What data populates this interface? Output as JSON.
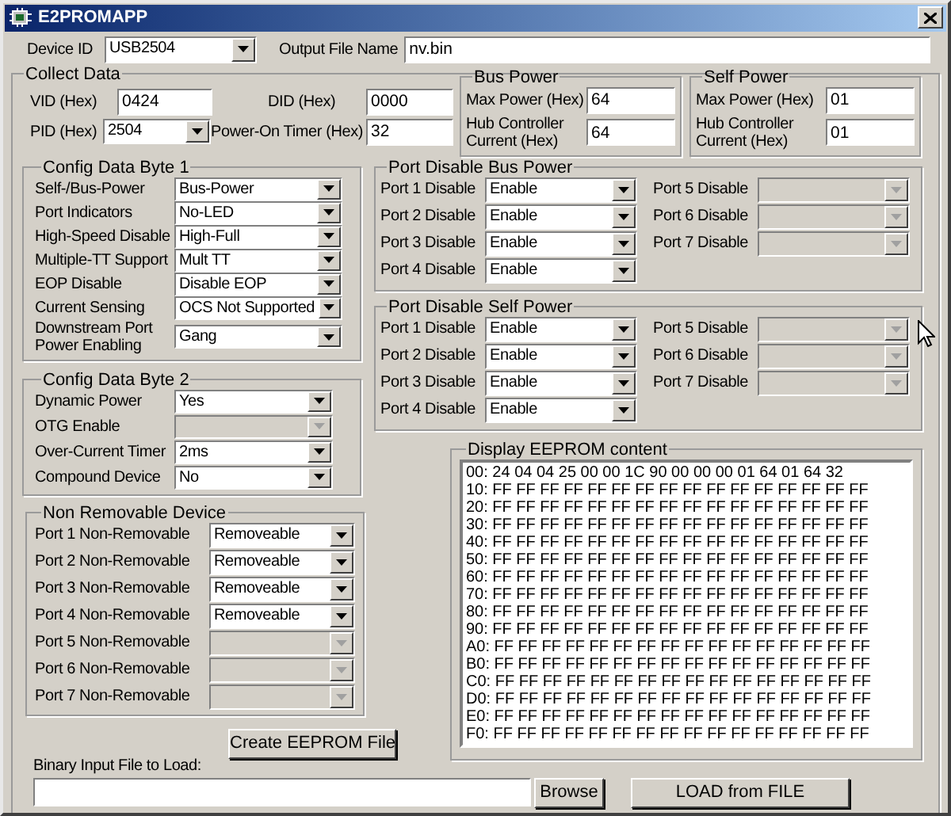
{
  "window": {
    "title": "E2PROMAPP"
  },
  "device_id": {
    "label": "Device ID",
    "value": "USB2504"
  },
  "output_file": {
    "label": "Output File Name",
    "value": "nv.bin"
  },
  "collect_data": {
    "title": "Collect Data",
    "ids": [
      {
        "label": "VID (Hex)",
        "value": "0424",
        "kind": "text"
      },
      {
        "label": "DID (Hex)",
        "value": "0000",
        "kind": "text"
      },
      {
        "label": "PID (Hex)",
        "value": "2504",
        "kind": "combo"
      },
      {
        "label": "Power-On Timer (Hex)",
        "value": "32",
        "kind": "text"
      }
    ],
    "bus_power": {
      "title": "Bus Power",
      "fields": [
        {
          "label": "Max Power (Hex)",
          "value": "64"
        },
        {
          "label": "Hub Controller Current (Hex)",
          "value": "64"
        }
      ]
    },
    "self_power": {
      "title": "Self Power",
      "fields": [
        {
          "label": "Max Power (Hex)",
          "value": "01"
        },
        {
          "label": "Hub Controller Current (Hex)",
          "value": "01"
        }
      ]
    },
    "config_byte_1": {
      "title": "Config Data Byte 1",
      "rows": [
        {
          "label": "Self-/Bus-Power",
          "value": "Bus-Power",
          "disabled": false
        },
        {
          "label": "Port Indicators",
          "value": "No-LED",
          "disabled": false
        },
        {
          "label": "High-Speed Disable",
          "value": "High-Full",
          "disabled": false
        },
        {
          "label": "Multiple-TT Support",
          "value": "Mult TT",
          "disabled": false
        },
        {
          "label": "EOP Disable",
          "value": "Disable EOP",
          "disabled": false
        },
        {
          "label": "Current Sensing",
          "value": "OCS Not Supported",
          "disabled": false
        },
        {
          "label": "Downstream Port Power Enabling",
          "value": "Gang",
          "disabled": false
        }
      ]
    },
    "config_byte_2": {
      "title": "Config Data Byte 2",
      "rows": [
        {
          "label": "Dynamic Power",
          "value": "Yes",
          "disabled": false
        },
        {
          "label": "OTG Enable",
          "disabled": true
        },
        {
          "label": "Over-Current Timer",
          "value": "2ms",
          "disabled": false
        },
        {
          "label": "Compound Device",
          "value": "No",
          "disabled": false
        }
      ]
    },
    "non_removable": {
      "title": "Non Removable Device",
      "rows": [
        {
          "label": "Port 1 Non-Removable",
          "value": "Removeable",
          "disabled": false
        },
        {
          "label": "Port 2 Non-Removable",
          "value": "Removeable",
          "disabled": false
        },
        {
          "label": "Port 3 Non-Removable",
          "value": "Removeable",
          "disabled": false
        },
        {
          "label": "Port 4 Non-Removable",
          "value": "Removeable",
          "disabled": false
        },
        {
          "label": "Port 5 Non-Removable",
          "disabled": true
        },
        {
          "label": "Port 6 Non-Removable",
          "disabled": true
        },
        {
          "label": "Port 7 Non-Removable",
          "disabled": true
        }
      ]
    },
    "create_button": "Create EEPROM File",
    "port_disable_bus": {
      "title": "Port Disable Bus Power",
      "rows": [
        {
          "label": "Port 1 Disable",
          "value": "Enable",
          "disabled": false
        },
        {
          "label": "Port 2 Disable",
          "value": "Enable",
          "disabled": false
        },
        {
          "label": "Port 3 Disable",
          "value": "Enable",
          "disabled": false
        },
        {
          "label": "Port 4 Disable",
          "value": "Enable",
          "disabled": false
        },
        {
          "label": "Port 5 Disable",
          "disabled": true
        },
        {
          "label": "Port 6 Disable",
          "disabled": true
        },
        {
          "label": "Port 7 Disable",
          "disabled": true
        }
      ]
    },
    "port_disable_self": {
      "title": "Port Disable Self Power",
      "rows": [
        {
          "label": "Port 1 Disable",
          "value": "Enable",
          "disabled": false
        },
        {
          "label": "Port 2 Disable",
          "value": "Enable",
          "disabled": false
        },
        {
          "label": "Port 3 Disable",
          "value": "Enable",
          "disabled": false
        },
        {
          "label": "Port 4 Disable",
          "value": "Enable",
          "disabled": false
        },
        {
          "label": "Port 5 Disable",
          "disabled": true
        },
        {
          "label": "Port 6 Disable",
          "disabled": true
        },
        {
          "label": "Port 7 Disable",
          "disabled": true
        }
      ]
    },
    "eeprom": {
      "title": "Display EEPROM content",
      "lines": [
        "00: 24 04 04 25 00 00 1C 90 00 00 00 01 64 01 64 32",
        "10: FF FF FF FF FF FF FF FF FF FF FF FF FF FF FF FF",
        "20: FF FF FF FF FF FF FF FF FF FF FF FF FF FF FF FF",
        "30: FF FF FF FF FF FF FF FF FF FF FF FF FF FF FF FF",
        "40: FF FF FF FF FF FF FF FF FF FF FF FF FF FF FF FF",
        "50: FF FF FF FF FF FF FF FF FF FF FF FF FF FF FF FF",
        "60: FF FF FF FF FF FF FF FF FF FF FF FF FF FF FF FF",
        "70: FF FF FF FF FF FF FF FF FF FF FF FF FF FF FF FF",
        "80: FF FF FF FF FF FF FF FF FF FF FF FF FF FF FF FF",
        "90: FF FF FF FF FF FF FF FF FF FF FF FF FF FF FF FF",
        "A0: FF FF FF FF FF FF FF FF FF FF FF FF FF FF FF FF",
        "B0: FF FF FF FF FF FF FF FF FF FF FF FF FF FF FF FF",
        "C0: FF FF FF FF FF FF FF FF FF FF FF FF FF FF FF FF",
        "D0: FF FF FF FF FF FF FF FF FF FF FF FF FF FF FF FF",
        "E0: FF FF FF FF FF FF FF FF FF FF FF FF FF FF FF FF",
        "F0: FF FF FF FF FF FF FF FF FF FF FF FF FF FF FF FF"
      ]
    },
    "binary_input": {
      "label": "Binary Input File to Load:"
    },
    "browse_button": "Browse",
    "load_button": "LOAD from FILE"
  }
}
